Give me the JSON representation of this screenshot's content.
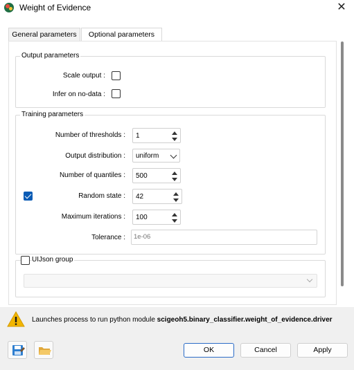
{
  "window": {
    "title": "Weight of Evidence"
  },
  "tabs": [
    {
      "label": "General parameters",
      "active": false
    },
    {
      "label": "Optional parameters",
      "active": true
    }
  ],
  "output_parameters": {
    "title": "Output parameters",
    "scale_output": {
      "label": "Scale output :",
      "checked": false
    },
    "infer_on_nodata": {
      "label": "Infer on no-data :",
      "checked": false
    }
  },
  "training_parameters": {
    "title": "Training parameters",
    "number_of_thresholds": {
      "label": "Number of thresholds :",
      "value": "1"
    },
    "output_distribution": {
      "label": "Output distribution :",
      "value": "uniform"
    },
    "number_of_quantiles": {
      "label": "Number of quantiles :",
      "value": "500"
    },
    "random_state": {
      "label": "Random state :",
      "value": "42",
      "enabled": true
    },
    "maximum_iterations": {
      "label": "Maximum iterations :",
      "value": "100"
    },
    "tolerance": {
      "label": "Tolerance :",
      "placeholder": "1e-06"
    }
  },
  "uijson_group": {
    "label": "UIJson group",
    "checked": false
  },
  "message": {
    "prefix": "Launches process to run python module ",
    "module": "scigeoh5.binary_classifier.weight_of_evidence.driver"
  },
  "buttons": {
    "ok": "OK",
    "cancel": "Cancel",
    "apply": "Apply"
  },
  "colors": {
    "accent": "#0a5bb5",
    "warning": "#f2b600",
    "footer": "#f0f0f0"
  },
  "icons": {
    "save": "save-icon",
    "open": "folder-open-icon",
    "warning": "warning-icon",
    "close": "close-icon"
  }
}
